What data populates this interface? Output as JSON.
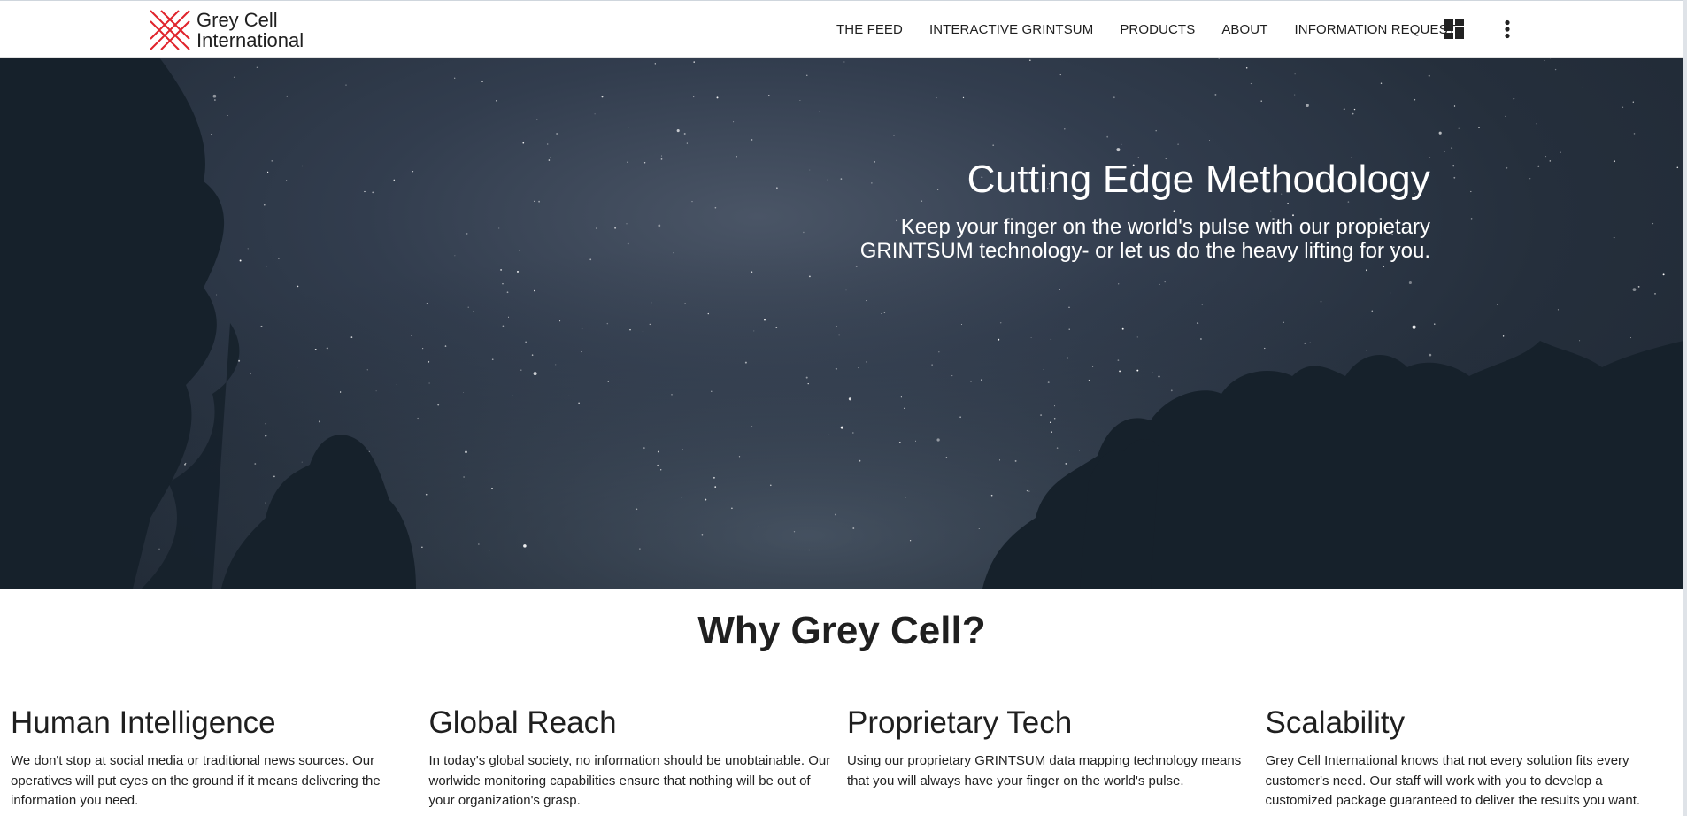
{
  "brand": {
    "line1": "Grey Cell",
    "line2": "International",
    "logo_icon": "grey-cell-lattice-logo",
    "logo_color": "#e0232b"
  },
  "nav": {
    "items": [
      {
        "label": "THE FEED"
      },
      {
        "label": "INTERACTIVE GRINTSUM"
      },
      {
        "label": "PRODUCTS"
      },
      {
        "label": "ABOUT"
      },
      {
        "label": "INFORMATION REQUEST"
      }
    ],
    "dashboard_icon": "dashboard-icon",
    "more_icon": "more-vertical-icon"
  },
  "hero": {
    "title": "Cutting Edge Methodology",
    "subtitle_line1": "Keep your finger on the world's pulse with our propietary",
    "subtitle_line2": "GRINTSUM technology- or let us do the heavy lifting for you.",
    "background": "night-sky-with-trees"
  },
  "why": {
    "title": "Why Grey Cell?",
    "accent_color": "#d9534f",
    "features": [
      {
        "title": "Human Intelligence",
        "text": "We don't stop at social media or traditional news sources. Our operatives will put eyes on the ground if it means delivering the information you need."
      },
      {
        "title": "Global Reach",
        "text": "In today's global society, no information should be unobtainable. Our worlwide monitoring capabilities ensure that nothing will be out of your organization's grasp."
      },
      {
        "title": "Proprietary Tech",
        "text": "Using our proprietary GRINTSUM data mapping technology means that you will always have your finger on the world's pulse."
      },
      {
        "title": "Scalability",
        "text": "Grey Cell International knows that not every solution fits every customer's need. Our staff will work with you to develop a customized package guaranteed to deliver the results you want."
      }
    ]
  }
}
